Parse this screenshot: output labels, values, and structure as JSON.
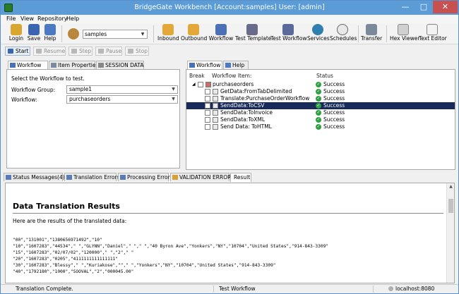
{
  "window": {
    "title": "BridgeGate Workbench [Account:samples] User: [admin]"
  },
  "menu": [
    "File",
    "View",
    "Repository",
    "Help"
  ],
  "toolbar": {
    "buttons": [
      "Login",
      "Save",
      "Help",
      "Inbound",
      "Outbound",
      "Workflow",
      "Test Template",
      "Test Workflow",
      "Services",
      "Schedules",
      "Transfer",
      "Hex Viewer",
      "Text Editor"
    ],
    "account_value": "samples"
  },
  "runbar": [
    "Start",
    "Resume",
    "Step",
    "Pause",
    "Stop"
  ],
  "left_panel": {
    "tabs": [
      "Workflow",
      "Item Properties",
      "SESSION DATA"
    ],
    "instruction": "Select the Workflow to test.",
    "group_label": "Workflow Group:",
    "group_value": "sample1",
    "workflow_label": "Workflow:",
    "workflow_value": "purchaseorders"
  },
  "right_panel": {
    "tabs": [
      "Workflow",
      "Help"
    ],
    "columns": [
      "Break",
      "Workflow Item:",
      "Status"
    ],
    "rows": [
      {
        "name": "purchaseorders",
        "status": "Success"
      },
      {
        "name": "GetData:FromTabDelimited",
        "status": "Success"
      },
      {
        "name": "Translate:PurchaseOrderWorkflow",
        "status": "Success"
      },
      {
        "name": "SendData:ToCSV",
        "status": "Success"
      },
      {
        "name": "SendData:ToInvoice",
        "status": "Success"
      },
      {
        "name": "SendData:ToXML",
        "status": "Success"
      },
      {
        "name": "Send Data: ToHTML",
        "status": "Success"
      }
    ]
  },
  "bottom_tabs": [
    "Status Messages(4)",
    "Translation Errors",
    "Processing Errors",
    "VALIDATION ERRORS",
    "Result"
  ],
  "result": {
    "heading": "Data Translation Results",
    "intro": "Here are the results of the translated data:",
    "lines": [
      "\"00\",\"131001\",\"1380656971492\",\"10\"",
      "\"10\",\"1607283\",\"44534\",\" \",\"GLYNN\",\"Daniel\",\" \",\" \",\"40 Byron Ave\",\"Yonkers\",\"NY\",\"10704\",\"United States\",\"914-843-3309\"",
      "\"15\",\"1607283\",\"02/07/02\",\"120000\",\" \",\"2\",\" \"",
      "\"20\",\"1607283\",\"0205\",\"4111111111111111\"",
      "\"30\",\"1607283\",\"Blessy\",\" \",\"Kuriakose\",\"\",\" \",\"Yonkers\",\"NY\",\"10704\",\"United States\",\"914-843-3309\"",
      "\"40\",\"1792180\",\"1000\",\"SOOVAL\",\"2\",\"000045.00\""
    ]
  },
  "status": {
    "message": "Translation Complete.",
    "workflow": "Test Workflow",
    "server": "localhost:8080"
  }
}
